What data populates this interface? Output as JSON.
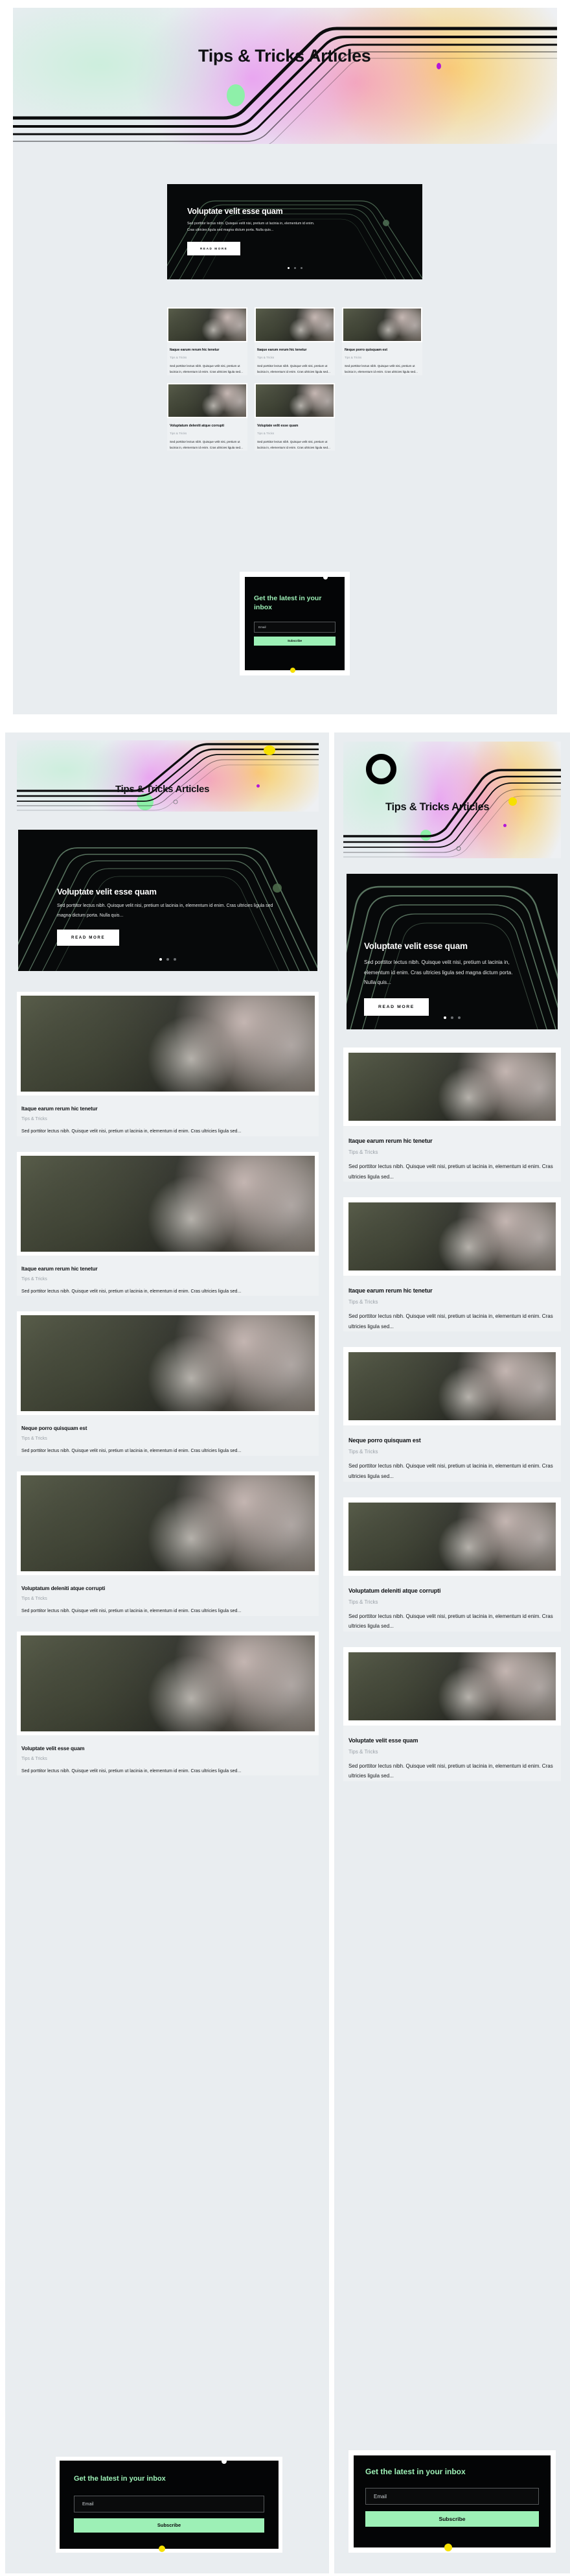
{
  "page": {
    "title": "Tips & Tricks Articles",
    "background_color": "#e9edf0",
    "accent_green": "#9df0b6",
    "accent_yellow": "#f6e000",
    "accent_purple": "#b416d8"
  },
  "hero": {
    "title": "Voluptate velit esse quam",
    "excerpt": "Sed porttitor lectus nibh. Quisque velit nisi, pretium ut lacinia in, elementum id enim. Cras ultricies ligula sed magna dictum porta. Nulla quis...",
    "button_label": "READ MORE",
    "slide_count": 3,
    "active_slide": 1
  },
  "articles": [
    {
      "title": "Itaque earum rerum hic tenetur",
      "category": "Tips & Tricks",
      "excerpt": "Sed porttitor lectus nibh. Quisque velit nisi, pretium ut lacinia in, elementum id enim. Cras ultricies ligula sed..."
    },
    {
      "title": "Itaque earum rerum hic tenetur",
      "category": "Tips & Tricks",
      "excerpt": "Sed porttitor lectus nibh. Quisque velit nisi, pretium ut lacinia in, elementum id enim. Cras ultricies ligula sed..."
    },
    {
      "title": "Neque porro quisquam est",
      "category": "Tips & Tricks",
      "excerpt": "Sed porttitor lectus nibh. Quisque velit nisi, pretium ut lacinia in, elementum id enim. Cras ultricies ligula sed..."
    },
    {
      "title": "Voluptatum deleniti atque corrupti",
      "category": "Tips & Tricks",
      "excerpt": "Sed porttitor lectus nibh. Quisque velit nisi, pretium ut lacinia in, elementum id enim. Cras ultricies ligula sed..."
    },
    {
      "title": "Voluptate velit esse quam",
      "category": "Tips & Tricks",
      "excerpt": "Sed porttitor lectus nibh. Quisque velit nisi, pretium ut lacinia in, elementum id enim. Cras ultricies ligula sed..."
    }
  ],
  "newsletter": {
    "heading": "Get the latest in your inbox",
    "email_placeholder": "Email",
    "email_value": "",
    "subscribe_label": "Subscribe"
  }
}
